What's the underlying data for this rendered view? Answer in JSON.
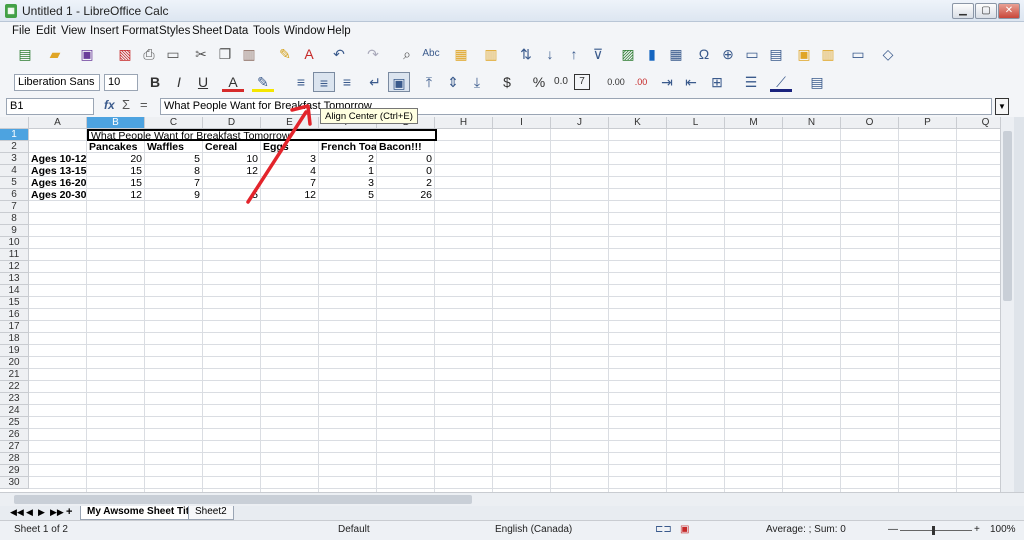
{
  "window": {
    "title": "Untitled 1 - LibreOffice Calc",
    "app_icon": "calc-icon",
    "min": "▁",
    "max": "▢",
    "close": "✕"
  },
  "menu": [
    "File",
    "Edit",
    "View",
    "Insert",
    "Format",
    "Styles",
    "Sheet",
    "Data",
    "Tools",
    "Window",
    "Help"
  ],
  "doc_close": "✕",
  "toolbar_icons": [
    "new-icon",
    "open-icon",
    "save-icon",
    "export-pdf-icon",
    "print-icon",
    "print-preview-icon",
    "cut-icon",
    "copy-icon",
    "paste-icon",
    "clone-format-icon",
    "clear-format-icon",
    "undo-icon",
    "redo-icon",
    "find-replace-icon",
    "spellcheck-icon",
    "row-icon",
    "column-icon",
    "sort-icon",
    "sort-asc-icon",
    "sort-desc-icon",
    "autofilter-icon",
    "image-icon",
    "chart-icon",
    "pivot-table-icon",
    "special-char-icon",
    "hyperlink-icon",
    "comment-icon",
    "header-footer-icon",
    "define-print-area-icon",
    "freeze-icon",
    "split-window-icon",
    "draw-shapes-icon"
  ],
  "format": {
    "font_name": "Liberation Sans",
    "font_size": "10",
    "bold": "B",
    "italic": "I",
    "underline": "U",
    "font_color_glyph": "A",
    "font_color": "#d62b2b",
    "highlight_color": "#f5e600",
    "currency": "$",
    "percent": "%",
    "number": "0.0",
    "date": "7",
    "add_decimal": "0.00",
    "del_decimal": ".00"
  },
  "formula_bar": {
    "name_box": "B1",
    "fx": "fx",
    "sum": "Σ",
    "equals": "=",
    "content": "What People Want for Breakfast Tomorrow"
  },
  "tooltip": "Align Center (Ctrl+E)",
  "columns": [
    "A",
    "B",
    "C",
    "D",
    "E",
    "F",
    "G",
    "H",
    "I",
    "J",
    "K",
    "L",
    "M",
    "N",
    "O",
    "P",
    "Q"
  ],
  "rows": [
    "1",
    "2",
    "3",
    "4",
    "5",
    "6",
    "7",
    "8",
    "9",
    "10",
    "11",
    "12",
    "13",
    "14",
    "15",
    "16",
    "17",
    "18",
    "19",
    "20",
    "21",
    "22",
    "23",
    "24",
    "25",
    "26",
    "27",
    "28",
    "29",
    "30"
  ],
  "cells": {
    "B1": "What People Want for Breakfast Tomorrow",
    "headers": [
      "Pancakes",
      "Waffles",
      "Cereal",
      "Eggs",
      "French Toast",
      "Bacon!!!"
    ],
    "row_labels": [
      "Ages 10-12",
      "Ages 13-15",
      "Ages 16-20",
      "Ages 20-30"
    ],
    "data": [
      [
        "20",
        "5",
        "10",
        "3",
        "2",
        "0"
      ],
      [
        "15",
        "8",
        "12",
        "4",
        "1",
        "0"
      ],
      [
        "15",
        "7",
        "",
        "7",
        "3",
        "2"
      ],
      [
        "12",
        "9",
        "5",
        "12",
        "5",
        "26"
      ]
    ]
  },
  "sheet_tabs": [
    "My Awsome Sheet Title",
    "Sheet2"
  ],
  "sheet_nav": [
    "◀◀",
    "◀",
    "▶",
    "▶▶",
    "+"
  ],
  "status": {
    "sheet": "Sheet 1 of 2",
    "style": "Default",
    "language": "English (Canada)",
    "sum": "Average: ; Sum: 0",
    "zoom": "100%",
    "zoom_minus": "—",
    "zoom_plus": "+"
  },
  "colors": {
    "selection": "#4da3e0",
    "arrow": "#e3242b"
  }
}
